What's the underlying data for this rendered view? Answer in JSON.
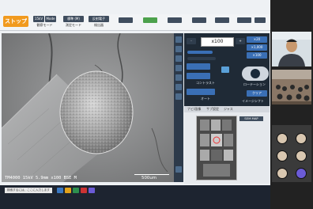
{
  "toolbar": {
    "stop_label": "ストップ",
    "group1": [
      "15kV",
      "Mode 2"
    ],
    "group1_sub": [
      "観察モード"
    ],
    "group2": [
      "標準 (M)"
    ],
    "group2_sub": [
      "測定モード"
    ],
    "group3": [
      "反射電子"
    ],
    "group3_sub": [
      "検出器"
    ],
    "icons": [
      "",
      "",
      "",
      "",
      "",
      "",
      "",
      ""
    ]
  },
  "sem": {
    "info": "TM4000 15kV 5.9mm x100 BSE M",
    "scale": "500um"
  },
  "panel": {
    "magnification": "x100",
    "btn_plus": "+",
    "btn_minus": "-",
    "right_btns": [
      "×20",
      "×1,000",
      "×100"
    ],
    "contrast_label": "コントラスト",
    "auto_label": "オート",
    "rotation_label": "ローテーション",
    "image_shift_label": "イメージシフト",
    "clear_label": "クリア"
  },
  "nav": {
    "tabs": [
      "ナビ/画像",
      "サブ設定",
      "ジャス"
    ],
    "button": "SEM MAP"
  },
  "taskbar": {
    "search_placeholder": "検索するには、ここに入力します"
  }
}
